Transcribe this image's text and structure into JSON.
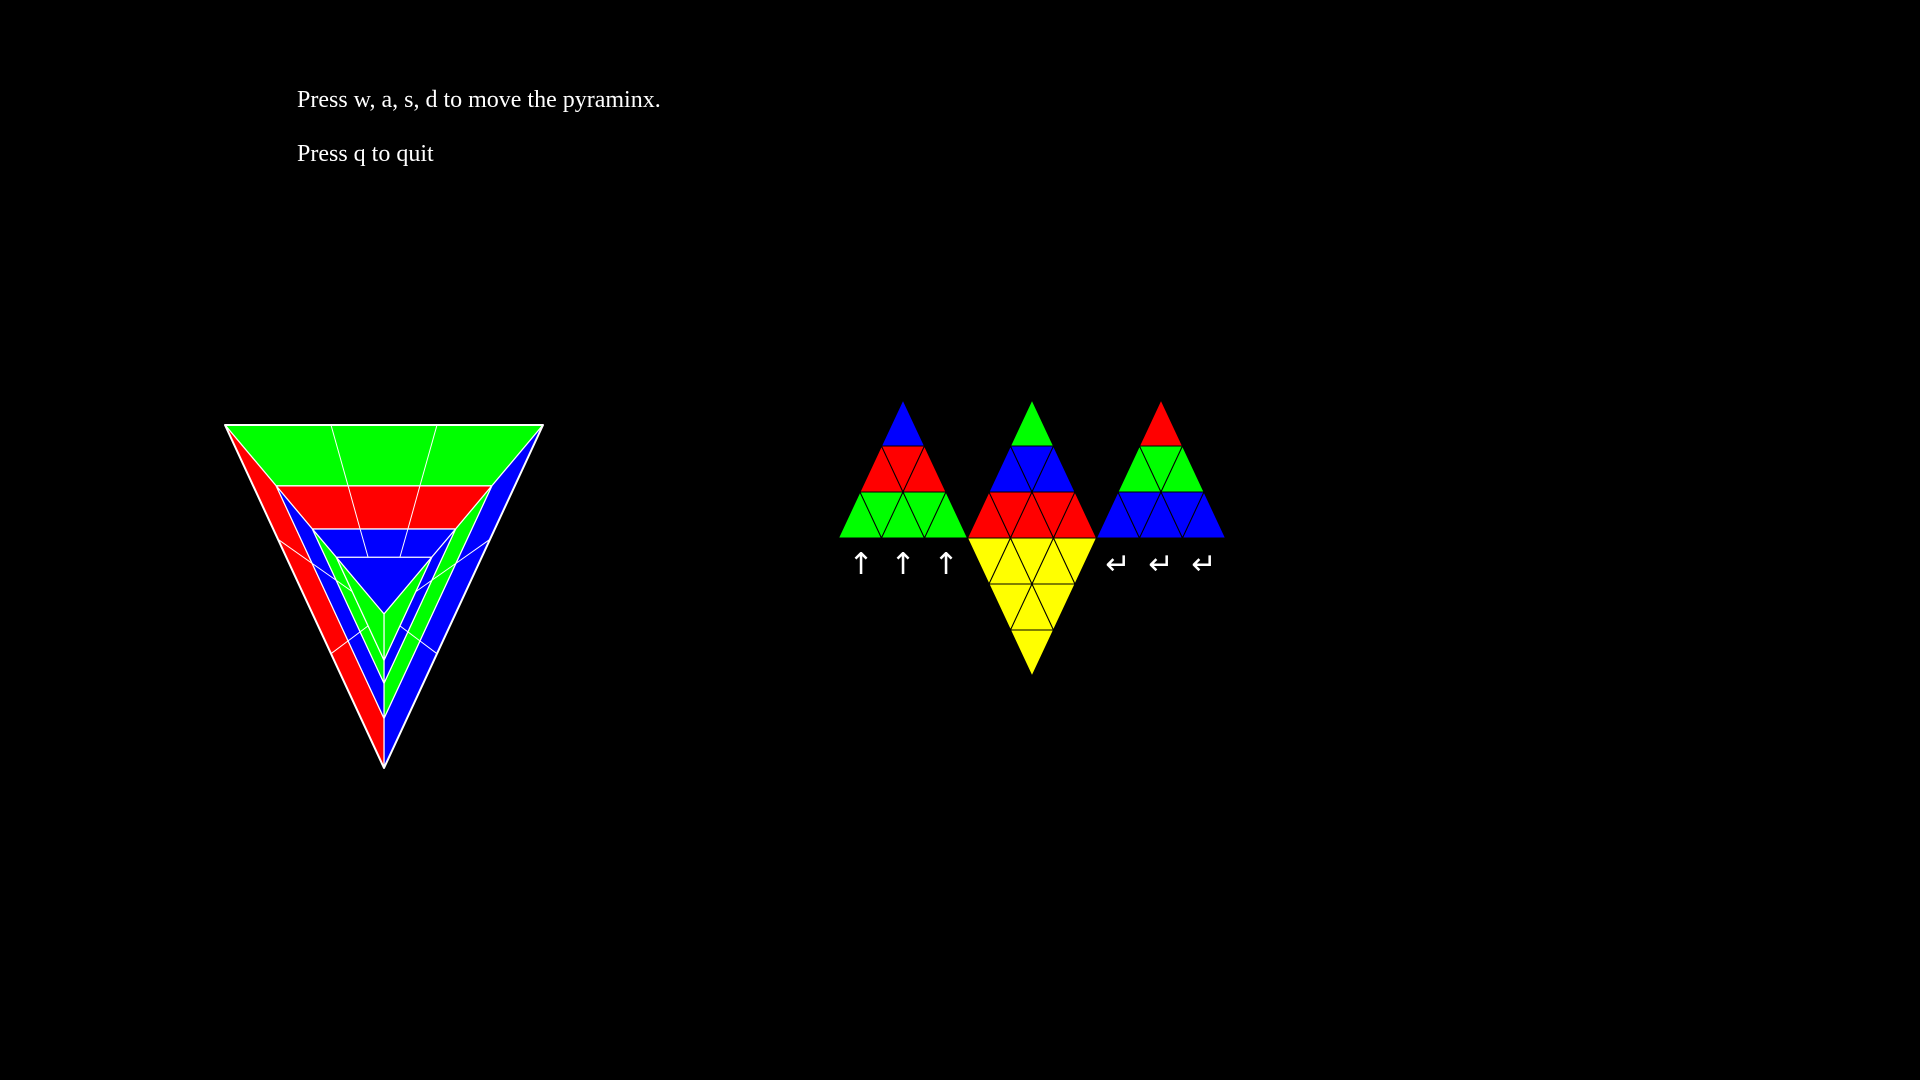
{
  "instructions": {
    "move": "Press w, a, s, d to move the pyraminx.",
    "quit": "Press q to quit"
  },
  "colors": {
    "background": "#000000",
    "red": "#ff0000",
    "green": "#00ff00",
    "blue": "#0000ff",
    "yellow": "#ffff00",
    "text": "#ffffff",
    "edge_3d": "#ffffff",
    "edge_net": "#000000"
  },
  "net": {
    "left_face": [
      [
        "blue"
      ],
      [
        "red",
        "red",
        "red"
      ],
      [
        "green",
        "green",
        "green",
        "green",
        "green"
      ]
    ],
    "center_face": [
      [
        "green"
      ],
      [
        "blue",
        "blue",
        "blue"
      ],
      [
        "red",
        "red",
        "red",
        "red",
        "red"
      ]
    ],
    "right_face": [
      [
        "red"
      ],
      [
        "green",
        "green",
        "green"
      ],
      [
        "blue",
        "blue",
        "blue",
        "blue",
        "blue"
      ]
    ],
    "bottom_face": [
      [
        "yellow",
        "yellow",
        "yellow",
        "yellow",
        "yellow"
      ],
      [
        "yellow",
        "yellow",
        "yellow"
      ],
      [
        "yellow"
      ]
    ]
  },
  "move_hints": {
    "up_arrows": [
      "↑",
      "↑",
      "↑"
    ],
    "return_arrows": [
      "↵",
      "↵",
      "↵"
    ],
    "up_icon": "up-arrow-icon",
    "return_icon": "return-arrow-icon"
  },
  "pyraminx_view": {
    "rings": [
      {
        "top": "green",
        "left": "red",
        "right": "blue"
      },
      {
        "top": "red",
        "left": "blue",
        "right": "green"
      },
      {
        "top": "blue",
        "left": "green",
        "right": "blue"
      }
    ],
    "center": {
      "top": "blue",
      "left": "green",
      "right": "green"
    }
  }
}
